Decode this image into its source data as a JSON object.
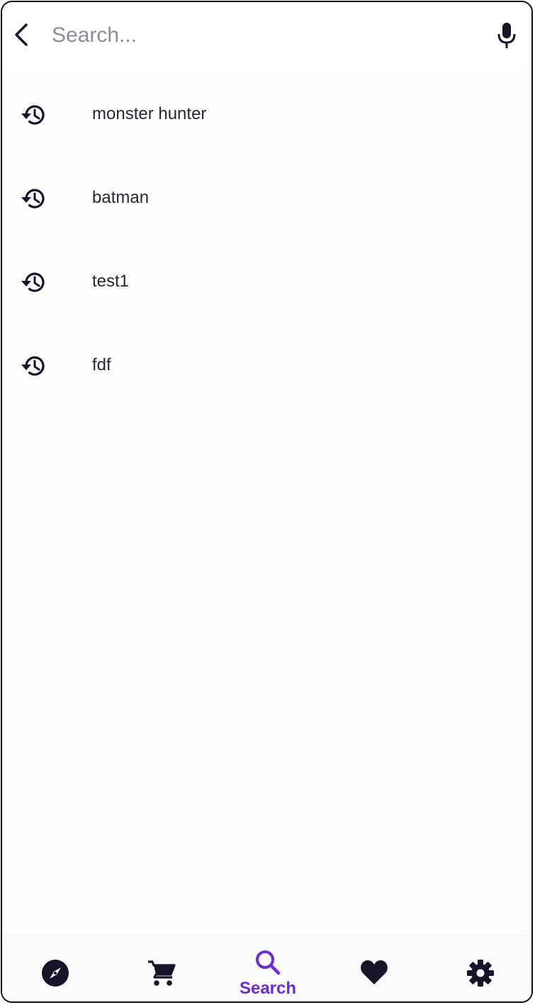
{
  "search": {
    "placeholder": "Search...",
    "value": ""
  },
  "icons": {
    "back": "back-arrow-icon",
    "mic": "microphone-icon",
    "history": "history-icon"
  },
  "history": [
    {
      "label": "monster hunter"
    },
    {
      "label": "batman"
    },
    {
      "label": "test1"
    },
    {
      "label": "fdf"
    }
  ],
  "nav": {
    "active_color": "#6b2bd9",
    "icon_color": "#17142a",
    "items": [
      {
        "icon": "compass-icon",
        "label": ""
      },
      {
        "icon": "cart-icon",
        "label": ""
      },
      {
        "icon": "search-icon",
        "label": "Search",
        "active": true
      },
      {
        "icon": "heart-icon",
        "label": ""
      },
      {
        "icon": "gear-icon",
        "label": ""
      }
    ]
  }
}
